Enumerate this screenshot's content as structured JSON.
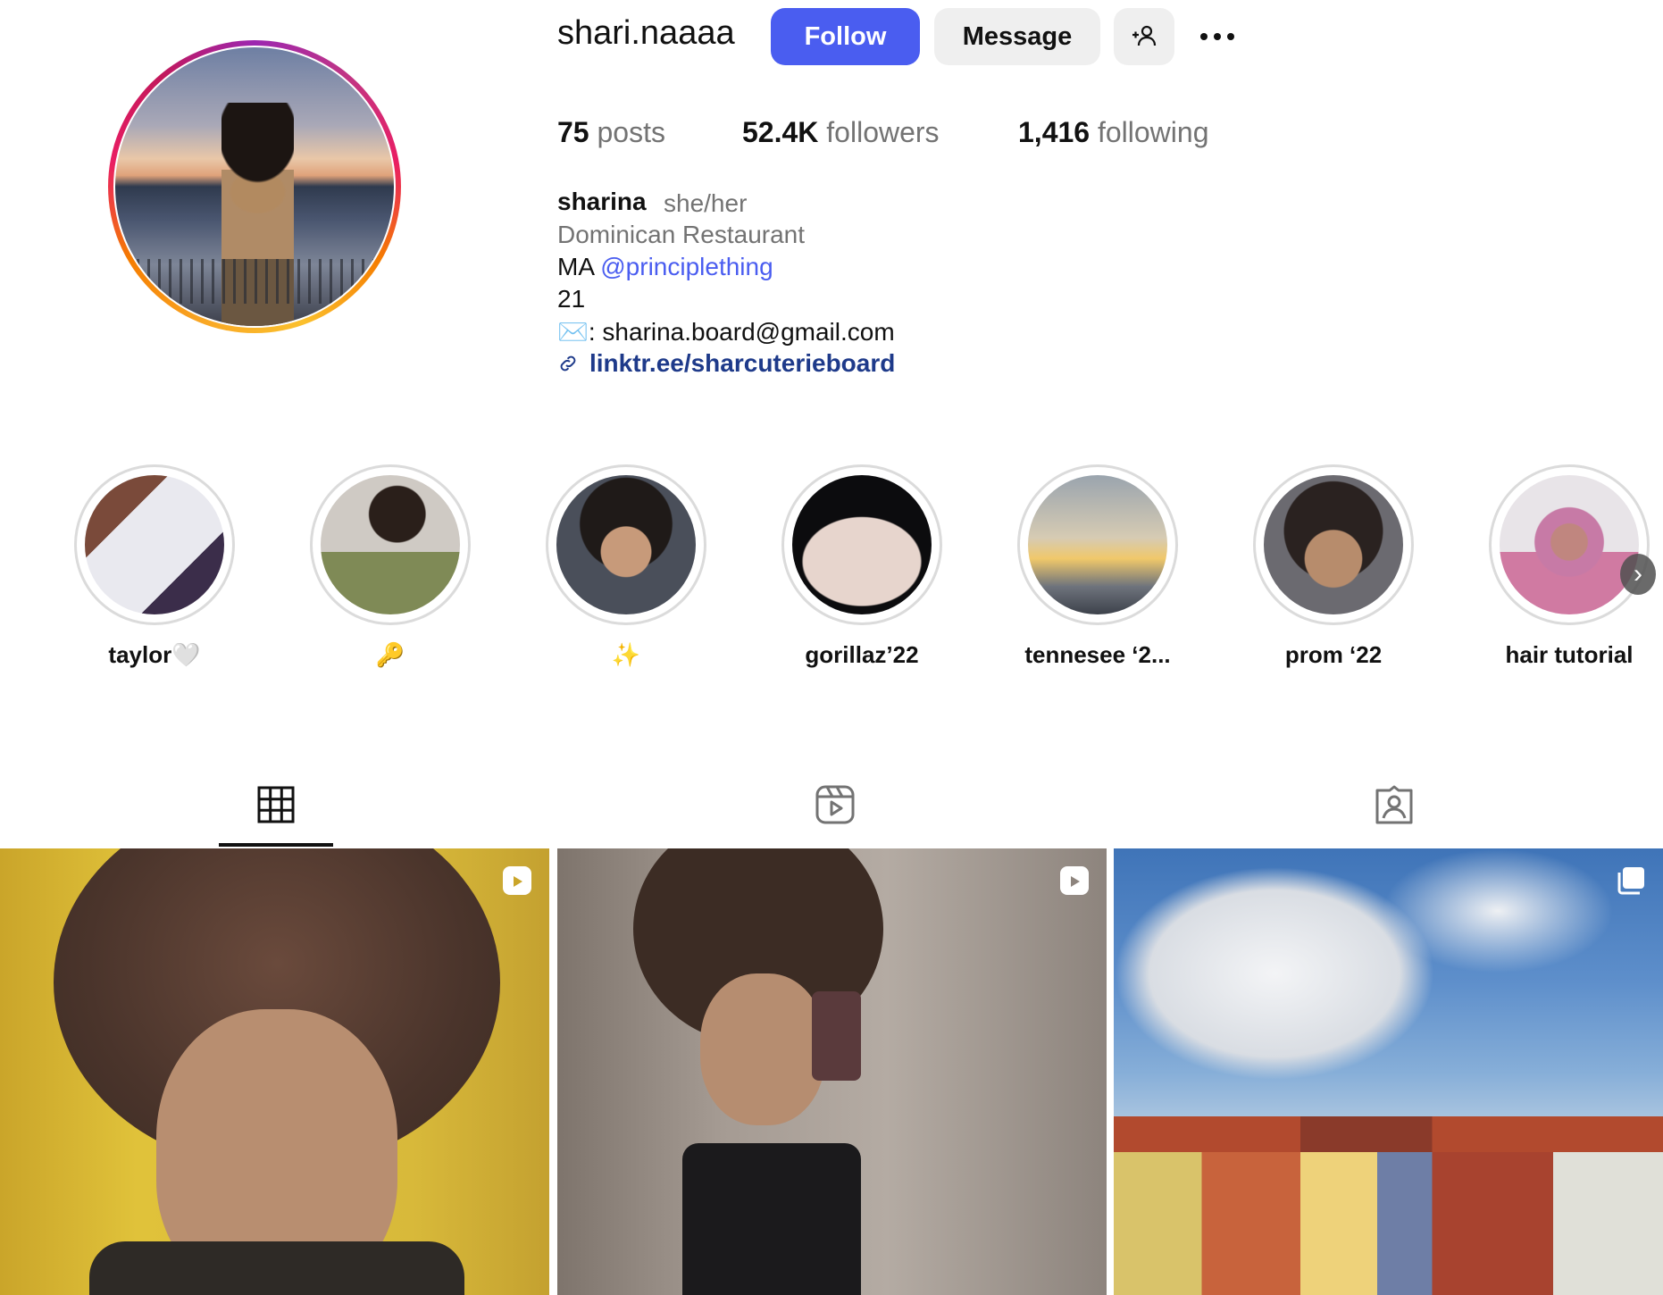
{
  "profile": {
    "username": "shari.naaaa",
    "follow_label": "Follow",
    "message_label": "Message",
    "stats": {
      "posts_count": "75",
      "posts_label": "posts",
      "followers_count": "52.4K",
      "followers_label": "followers",
      "following_count": "1,416",
      "following_label": "following"
    },
    "bio": {
      "name": "sharina",
      "pronouns": "she/her",
      "category": "Dominican Restaurant",
      "location_prefix": "MA",
      "mention": "@principlething",
      "age": "21",
      "email_line": "✉️: sharina.board@gmail.com",
      "link": "linktr.ee/sharcuterieboard"
    }
  },
  "highlights": [
    {
      "label": "taylor🤍"
    },
    {
      "label": "🔑"
    },
    {
      "label": "✨"
    },
    {
      "label": "gorillaz’22"
    },
    {
      "label": "tennesee ‘2..."
    },
    {
      "label": "prom ‘22"
    },
    {
      "label": "hair tutorial"
    }
  ],
  "tabs": {
    "active": "posts",
    "icons": [
      "grid-icon",
      "reels-icon",
      "tagged-icon"
    ]
  },
  "colors": {
    "accent": "#4a5df0",
    "link": "#1e3a8a",
    "secondary_text": "#737373",
    "button_bg": "#efefef"
  }
}
